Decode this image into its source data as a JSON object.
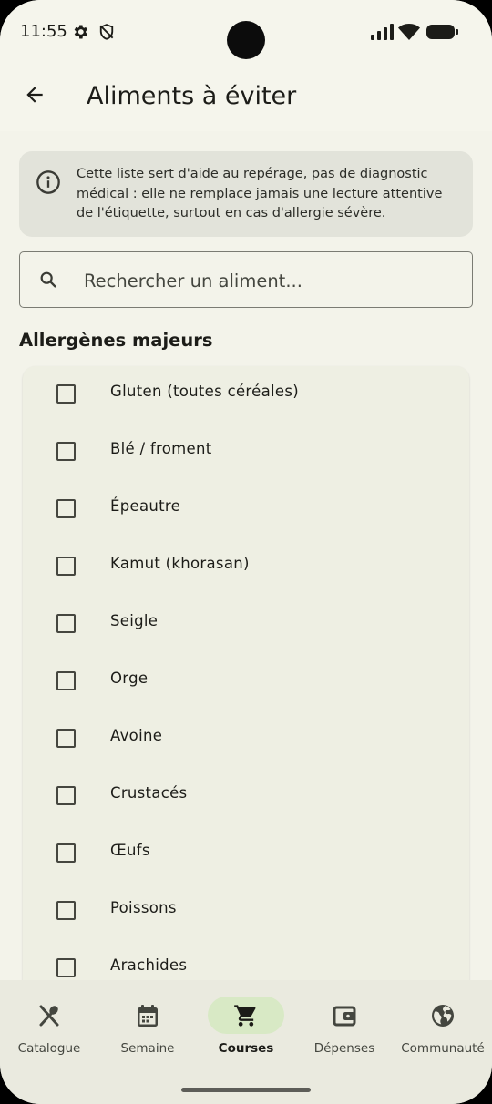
{
  "status_bar": {
    "time": "11:55",
    "icons": [
      "gear-icon",
      "shield-icon",
      "signal-icon",
      "wifi-icon",
      "battery-icon"
    ]
  },
  "app_bar": {
    "title": "Aliments à éviter",
    "back_icon": "arrow-back-icon"
  },
  "notice": {
    "icon": "info-icon",
    "text": "Cette liste sert d'aide au repérage, pas de diagnostic médical : elle ne remplace jamais une lecture attentive de l'étiquette, surtout en cas d'allergie sévère."
  },
  "search": {
    "placeholder": "Rechercher un aliment...",
    "value": "",
    "icon": "search-icon"
  },
  "section": {
    "title": "Allergènes majeurs",
    "items": [
      {
        "label": "Gluten (toutes céréales)",
        "checked": false
      },
      {
        "label": "Blé / froment",
        "checked": false
      },
      {
        "label": "Épeautre",
        "checked": false
      },
      {
        "label": "Kamut (khorasan)",
        "checked": false
      },
      {
        "label": "Seigle",
        "checked": false
      },
      {
        "label": "Orge",
        "checked": false
      },
      {
        "label": "Avoine",
        "checked": false
      },
      {
        "label": "Crustacés",
        "checked": false
      },
      {
        "label": "Œufs",
        "checked": false
      },
      {
        "label": "Poissons",
        "checked": false
      },
      {
        "label": "Arachides",
        "checked": false
      }
    ]
  },
  "bottom_nav": {
    "items": [
      {
        "label": "Catalogue",
        "icon": "utensils-icon",
        "active": false
      },
      {
        "label": "Semaine",
        "icon": "calendar-icon",
        "active": false
      },
      {
        "label": "Courses",
        "icon": "cart-icon",
        "active": true
      },
      {
        "label": "Dépenses",
        "icon": "wallet-icon",
        "active": false
      },
      {
        "label": "Communauté",
        "icon": "globe-icon",
        "active": false
      }
    ]
  },
  "colors": {
    "background": "#f5f5ec",
    "notice_bg": "#e2e3da",
    "card_bg": "#eeefe3",
    "nav_bg": "#eaeadf",
    "active_pill": "#d8e9c5",
    "text": "#1c1c18"
  }
}
